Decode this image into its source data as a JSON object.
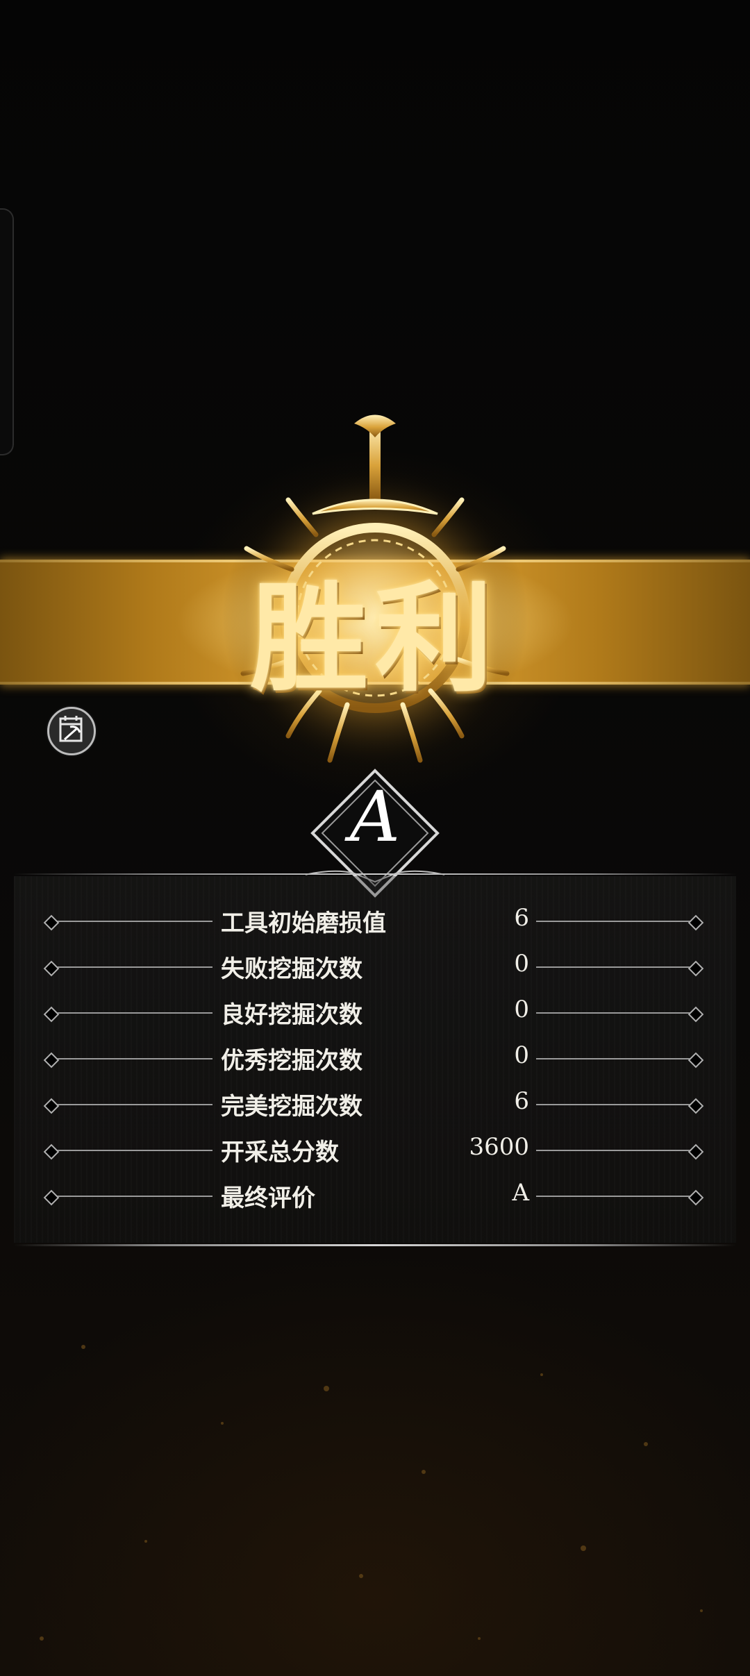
{
  "screen": {
    "title": "胜利",
    "grade": "A",
    "accent_gold": "#e2ac3f",
    "text_color": "#f1efe8"
  },
  "icons": {
    "emblem": "sword-sun-emblem-icon",
    "tool": "pickaxe-calendar-icon",
    "grade_frame": "diamond-frame-icon"
  },
  "stats": [
    {
      "label": "工具初始磨损值",
      "value": "6"
    },
    {
      "label": "失败挖掘次数",
      "value": "0"
    },
    {
      "label": "良好挖掘次数",
      "value": "0"
    },
    {
      "label": "优秀挖掘次数",
      "value": "0"
    },
    {
      "label": "完美挖掘次数",
      "value": "6"
    },
    {
      "label": "开采总分数",
      "value": "3600"
    },
    {
      "label": "最终评价",
      "value": "A"
    }
  ]
}
